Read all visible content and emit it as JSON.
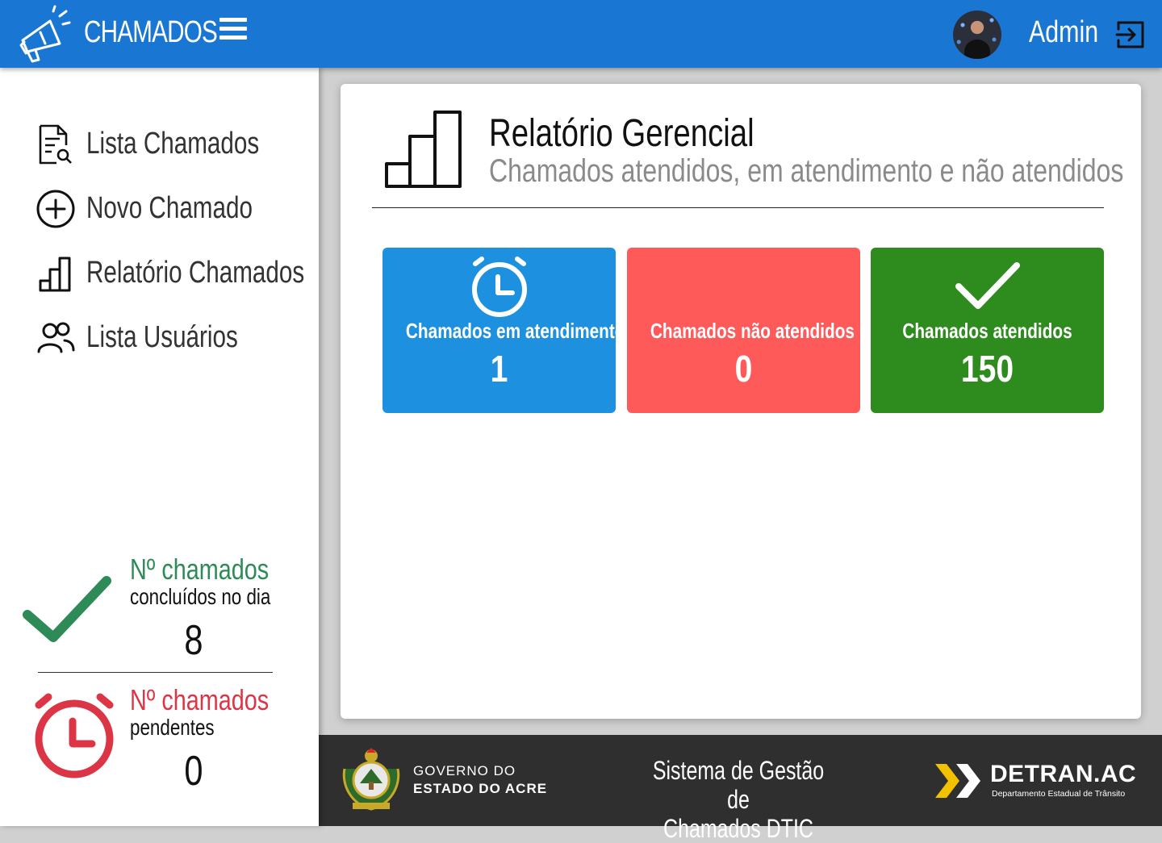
{
  "header": {
    "app_title": "CHAMADOS",
    "user_name": "Admin",
    "brand_color": "#1976d2"
  },
  "sidebar": {
    "items": [
      {
        "label": "Lista Chamados",
        "icon": "document-search-icon"
      },
      {
        "label": "Novo Chamado",
        "icon": "plus-circle-icon"
      },
      {
        "label": "Relatório Chamados",
        "icon": "bar-chart-icon"
      },
      {
        "label": "Lista Usuários",
        "icon": "users-icon"
      }
    ],
    "completed_today": {
      "title": "Nº chamados",
      "subtitle": "concluídos no dia",
      "value": "8",
      "color": "#2e8b57"
    },
    "pending": {
      "title": "Nº chamados",
      "subtitle": "pendentes",
      "value": "0",
      "color": "#dc3545"
    }
  },
  "main": {
    "title": "Relatório Gerencial",
    "subtitle": "Chamados atendidos, em atendimento e não atendidos",
    "cards": [
      {
        "label": "Chamados em atendimento",
        "value": "1",
        "color": "#1e90e0",
        "icon": "alarm-clock-icon"
      },
      {
        "label": "Chamados não atendidos",
        "value": "0",
        "color": "#ff5a5a",
        "icon": "none"
      },
      {
        "label": "Chamados atendidos",
        "value": "150",
        "color": "#2e8b1e",
        "icon": "check-icon"
      }
    ]
  },
  "footer": {
    "gov_line1": "GOVERNO DO",
    "gov_line2": "ESTADO DO ACRE",
    "system_line1": "Sistema de Gestão de",
    "system_line2": "Chamados DTIC",
    "detran_title": "DETRAN.AC",
    "detran_subtitle": "Departamento Estadual de Trânsito"
  }
}
